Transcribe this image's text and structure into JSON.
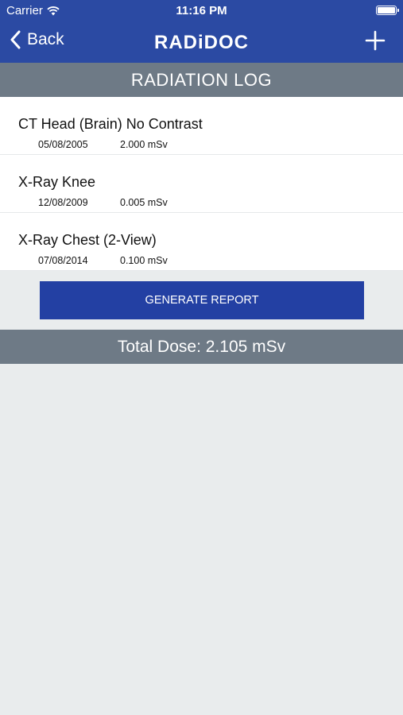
{
  "status_bar": {
    "carrier": "Carrier",
    "time": "11:16 PM",
    "battery_level": 1.0
  },
  "nav": {
    "back_label": "Back",
    "brand": "RADiDOC",
    "add_icon": "plus-icon"
  },
  "section": {
    "title": "RADIATION LOG"
  },
  "entries": [
    {
      "title": "CT Head (Brain) No Contrast",
      "date": "05/08/2005",
      "dose": "2.000 mSv"
    },
    {
      "title": "X-Ray Knee",
      "date": "12/08/2009",
      "dose": "0.005 mSv"
    },
    {
      "title": "X-Ray Chest (2-View)",
      "date": "07/08/2014",
      "dose": "0.100 mSv"
    }
  ],
  "actions": {
    "generate_report": "GENERATE REPORT"
  },
  "summary": {
    "total_dose": "Total Dose: 2.105 mSv"
  },
  "colors": {
    "nav_bg": "#2b4aa3",
    "header_bg": "#6e7a86",
    "button_bg": "#2340a3",
    "page_bg": "#e9eced"
  }
}
